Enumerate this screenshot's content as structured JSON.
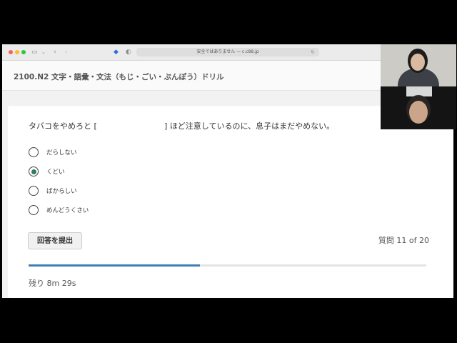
{
  "browser": {
    "address": "安全ではありません — c.c88.jp",
    "back_icon": "chevron-left-icon",
    "forward_icon": "chevron-right-icon",
    "reload_icon": "reload-icon"
  },
  "page": {
    "title": "2100.N2 文字・語彙・文法（もじ・ごい・ぶんぽう）ドリル"
  },
  "quiz": {
    "question_before": "タバコをやめろと [",
    "question_after": "] ほど注意しているのに、息子はまだやめない。",
    "options": [
      {
        "label": "だらしない",
        "selected": false
      },
      {
        "label": "くどい",
        "selected": true
      },
      {
        "label": "ばからしい",
        "selected": false
      },
      {
        "label": "めんどうくさい",
        "selected": false
      }
    ],
    "submit_label": "回答を提出",
    "counter": "質問 11 of 20",
    "progress": 0.43,
    "remaining": "残り 8m 29s"
  },
  "colors": {
    "accent": "#3f7fb5",
    "selected_radio": "#2e7d5b"
  }
}
